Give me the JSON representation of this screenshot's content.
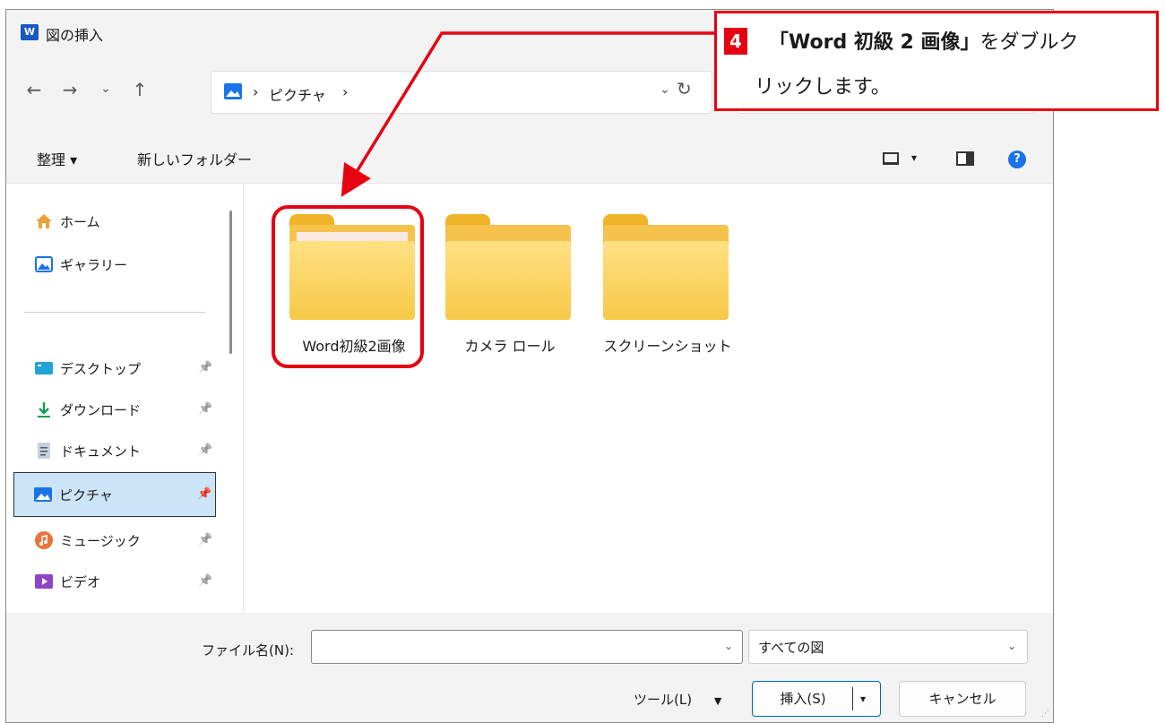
{
  "window": {
    "title": "図の挿入",
    "app_icon_letter": "W"
  },
  "nav": {
    "back_icon": "←",
    "forward_icon": "→",
    "recent_icon": "⌄",
    "up_icon": "↑",
    "breadcrumb_sep1": "›",
    "breadcrumb_pictures": "ピクチャ",
    "breadcrumb_sep2": "›",
    "address_dropdown": "⌄",
    "refresh_icon": "↻"
  },
  "command_bar": {
    "organize": "整理 ▾",
    "new_folder": "新しいフォルダー",
    "view_dropdown": "▾",
    "help": "?"
  },
  "sidebar": {
    "items": [
      {
        "label": "ホーム",
        "pinned": false
      },
      {
        "label": "ギャラリー",
        "pinned": false
      },
      {
        "label": "デスクトップ",
        "pinned": true
      },
      {
        "label": "ダウンロード",
        "pinned": true
      },
      {
        "label": "ドキュメント",
        "pinned": true
      },
      {
        "label": "ピクチャ",
        "pinned": true,
        "selected": true
      },
      {
        "label": "ミュージック",
        "pinned": true
      },
      {
        "label": "ビデオ",
        "pinned": true
      }
    ],
    "pin_glyph": "📌"
  },
  "folders": [
    {
      "name": "Word初級2画像",
      "has_preview": true
    },
    {
      "name": "カメラ ロール",
      "has_preview": false
    },
    {
      "name": "スクリーンショット",
      "has_preview": false
    }
  ],
  "footer": {
    "filename_label": "ファイル名(N):",
    "filename_value": "",
    "filetype_value": "すべての図",
    "tools_label": "ツール(L)",
    "tools_arrow": "▼",
    "insert_label": "挿入(S)",
    "insert_split": "▾",
    "cancel_label": "キャンセル",
    "dropdown_glyph": "⌄"
  },
  "callout": {
    "step_number": "4",
    "line1_bold": "「Word 初級 2 画像」",
    "line1_rest": "をダブルク",
    "line2": "リックします。"
  },
  "colors": {
    "accent_red": "#e60012",
    "selection_blue": "#cce4f7",
    "folder_yellow": "#f7c948"
  }
}
